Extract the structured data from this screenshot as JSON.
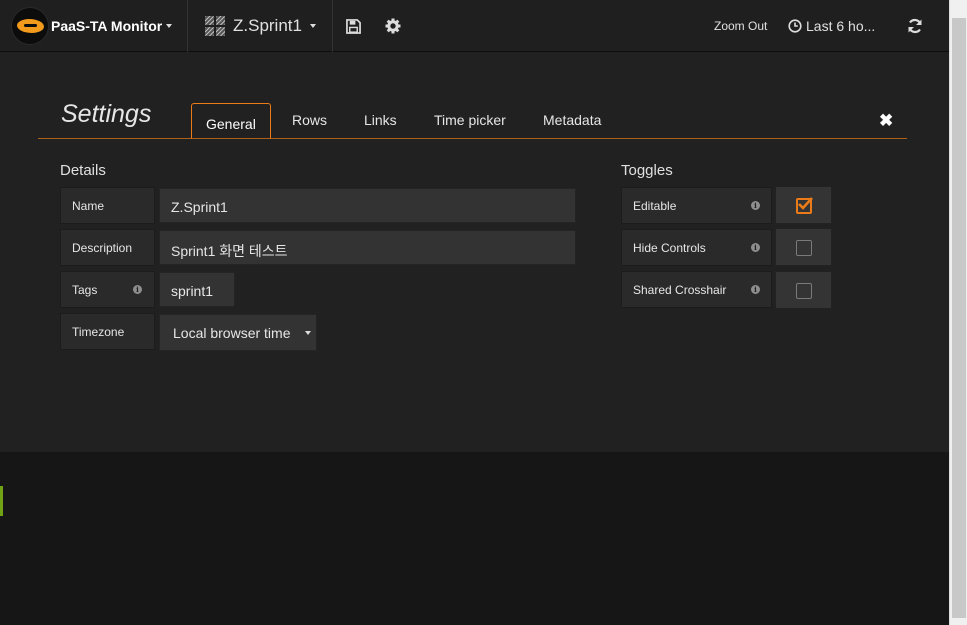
{
  "navbar": {
    "brand_label": "PaaS-TA Monitor",
    "dashboard_title": "Z.Sprint1",
    "zoom_out_label": "Zoom Out",
    "time_range_label": "Last 6 ho..."
  },
  "settings": {
    "title": "Settings",
    "tabs": [
      "General",
      "Rows",
      "Links",
      "Time picker",
      "Metadata"
    ],
    "active_tab": "General",
    "details": {
      "heading": "Details",
      "name_label": "Name",
      "name_value": "Z.Sprint1",
      "description_label": "Description",
      "description_value": "Sprint1 화면 테스트",
      "tags_label": "Tags",
      "tags": [
        "sprint1"
      ],
      "timezone_label": "Timezone",
      "timezone_value": "Local browser time"
    },
    "toggles": {
      "heading": "Toggles",
      "items": [
        {
          "label": "Editable",
          "checked": true
        },
        {
          "label": "Hide Controls",
          "checked": false
        },
        {
          "label": "Shared Crosshair",
          "checked": false
        }
      ]
    }
  },
  "colors": {
    "accent": "#eb7b18",
    "panel_bg": "#212121",
    "page_bg": "#161616",
    "marker": "#6fa214"
  },
  "icons": [
    "brand-logo-icon",
    "dashboard-grid-icon",
    "save-icon",
    "gear-icon",
    "clock-icon",
    "refresh-icon",
    "close-icon",
    "info-icon",
    "check-icon"
  ]
}
